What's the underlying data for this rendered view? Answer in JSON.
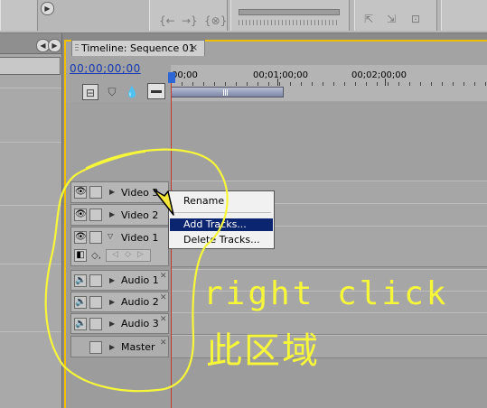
{
  "timeline": {
    "tab_title": "Timeline: Sequence 01",
    "tab_close": "×",
    "timecode": "00;00;00;00",
    "ruler_labels": [
      "00;00",
      "00;01;00;00",
      "00;02;00;00"
    ]
  },
  "tracks": [
    {
      "label": "Video 3",
      "kind": "video"
    },
    {
      "label": "Video 2",
      "kind": "video"
    },
    {
      "label": "Video 1",
      "kind": "video"
    },
    {
      "label": "Audio 1",
      "kind": "audio"
    },
    {
      "label": "Audio 2",
      "kind": "audio"
    },
    {
      "label": "Audio 3",
      "kind": "audio"
    },
    {
      "label": "Master",
      "kind": "master"
    }
  ],
  "context_menu": {
    "items": [
      "Rename",
      "Add Tracks...",
      "Delete Tracks..."
    ],
    "highlighted_index": 1
  },
  "annotation": {
    "line1": "right click",
    "line2": "此区域",
    "color": "#f7f73a"
  },
  "colors": {
    "selection": "#0b2571",
    "timecode": "#1538b0",
    "panel_focus": "#f0c000",
    "playhead": "#c0392b"
  }
}
